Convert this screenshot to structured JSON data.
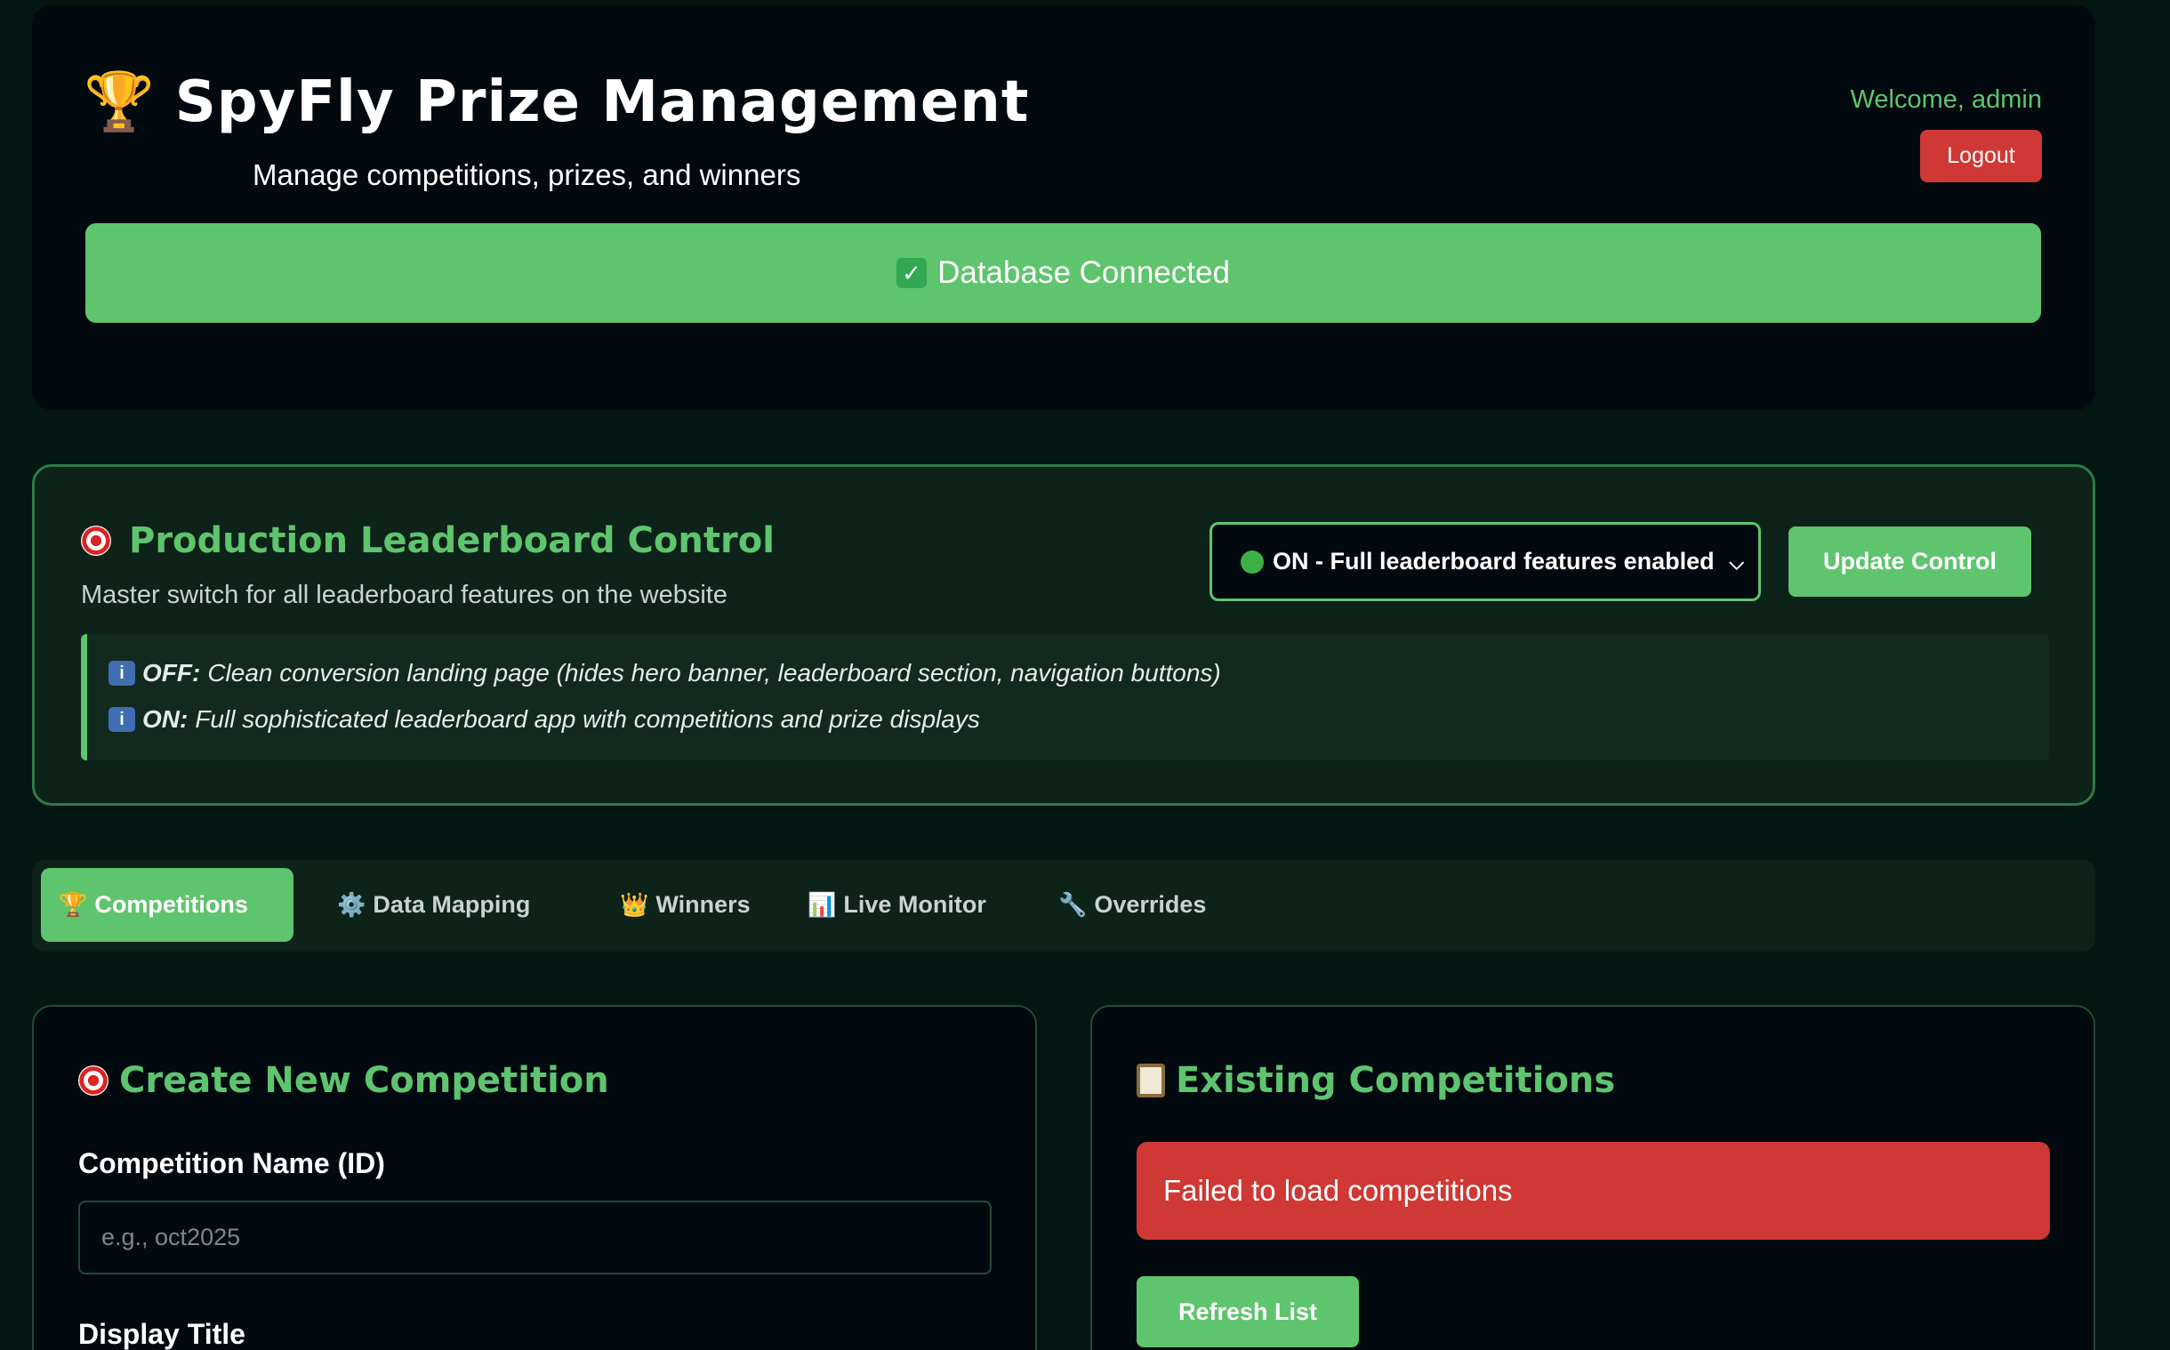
{
  "header": {
    "title": "SpyFly Prize Management",
    "subtitle": "Manage competitions, prizes, and winners",
    "welcome": "Welcome, admin",
    "logout_label": "Logout",
    "db_status": "Database Connected",
    "trophy_icon": "🏆"
  },
  "control": {
    "title": "Production Leaderboard Control",
    "description": "Master switch for all leaderboard features on the website",
    "select_value": "ON - Full leaderboard features enabled",
    "update_label": "Update Control",
    "info": [
      {
        "mode": "OFF:",
        "text": " Clean conversion landing page (hides hero banner, leaderboard section, navigation buttons)"
      },
      {
        "mode": "ON:",
        "text": " Full sophisticated leaderboard app with competitions and prize displays"
      }
    ]
  },
  "tabs": [
    {
      "icon": "🏆",
      "label": "Competitions",
      "active": true
    },
    {
      "icon": "⚙️",
      "label": "Data Mapping",
      "active": false
    },
    {
      "icon": "👑",
      "label": "Winners",
      "active": false
    },
    {
      "icon": "📊",
      "label": "Live Monitor",
      "active": false
    },
    {
      "icon": "🔧",
      "label": "Overrides",
      "active": false
    }
  ],
  "create_panel": {
    "title": "Create New Competition",
    "name_label": "Competition Name (ID)",
    "name_placeholder": "e.g., oct2025",
    "display_title_label": "Display Title"
  },
  "existing_panel": {
    "title": "Existing Competitions",
    "error": "Failed to load competitions",
    "refresh_label": "Refresh List"
  },
  "colors": {
    "accent": "#5fc46e",
    "danger": "#cf3834",
    "background": "#041611"
  }
}
